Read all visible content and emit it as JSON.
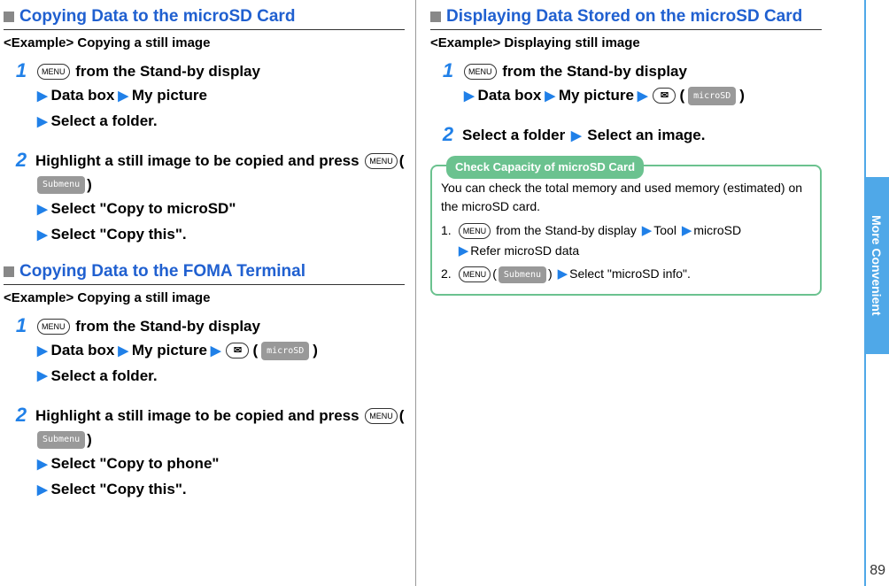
{
  "side_tab": "More Convenient",
  "page_number": "89",
  "buttons": {
    "menu": "MENU",
    "submenu": "Submenu",
    "microsd": "microSD"
  },
  "left": {
    "section1": {
      "title": "Copying Data to the microSD Card",
      "example": "<Example> Copying a still image",
      "step1": {
        "num": "1",
        "line1a": " from the Stand-by display",
        "line2a": "Data box",
        "line2b": "My picture",
        "line3": "Select a folder."
      },
      "step2": {
        "num": "2",
        "line1": "Highlight a still image to be copied and press ",
        "line2": "Select \"Copy to microSD\"",
        "line3": "Select \"Copy this\"."
      }
    },
    "section2": {
      "title": "Copying Data to the FOMA Terminal",
      "example": "<Example> Copying a still image",
      "step1": {
        "num": "1",
        "line1a": " from the Stand-by display",
        "line2a": "Data box",
        "line2b": "My picture",
        "line3": "Select a folder."
      },
      "step2": {
        "num": "2",
        "line1": "Highlight a still image to be copied and press ",
        "line2": "Select \"Copy to phone\"",
        "line3": "Select \"Copy this\"."
      }
    }
  },
  "right": {
    "section1": {
      "title": "Displaying Data Stored on the microSD Card",
      "example": "<Example> Displaying still image",
      "step1": {
        "num": "1",
        "line1a": " from the Stand-by display",
        "line2a": "Data box",
        "line2b": "My picture"
      },
      "step2": {
        "num": "2",
        "line1a": "Select a folder",
        "line1b": "Select an image."
      }
    },
    "tip": {
      "title": "Check Capacity of microSD Card",
      "intro": "You can check the total memory and used memory (estimated) on the microSD card.",
      "li1_num": "1.",
      "li1_a": " from the Stand-by display",
      "li1_b": "Tool",
      "li1_c": "microSD",
      "li1_d": "Refer microSD data",
      "li2_num": "2.",
      "li2_a": "Select \"microSD info\"."
    }
  }
}
